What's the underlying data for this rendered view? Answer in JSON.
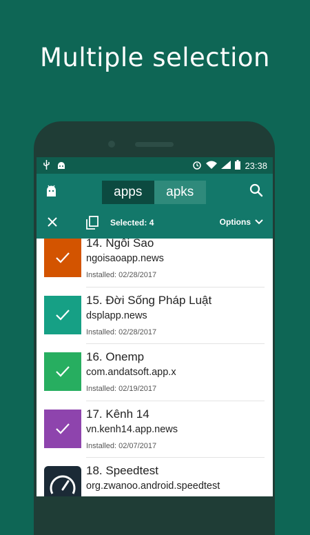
{
  "headline": "Multiple selection",
  "status_bar": {
    "time": "23:38"
  },
  "toolbar": {
    "tab_apps": "apps",
    "tab_apks": "apks",
    "active_tab": "apps"
  },
  "action_bar": {
    "selected": "Selected: 4",
    "options": "Options"
  },
  "apps": [
    {
      "title": "14. Ngôi Sao",
      "package": "ngoisaoapp.news",
      "installed": "Installed: 02/28/2017",
      "color": "#d35400",
      "selected": true
    },
    {
      "title": "15. Đời Sống Pháp Luật",
      "package": "dsplapp.news",
      "installed": "Installed: 02/28/2017",
      "color": "#16a085",
      "selected": true
    },
    {
      "title": "16. Onemp",
      "package": "com.andatsoft.app.x",
      "installed": "Installed: 02/19/2017",
      "color": "#27ae60",
      "selected": true
    },
    {
      "title": "17. Kênh 14",
      "package": "vn.kenh14.app.news",
      "installed": "Installed: 02/07/2017",
      "color": "#8e44ad",
      "selected": true
    },
    {
      "title": "18. Speedtest",
      "package": "org.zwanoo.android.speedtest",
      "installed": "",
      "color": "#1b2a36",
      "selected": false
    }
  ],
  "colors": {
    "background": "#0e6655",
    "toolbar": "#13786a",
    "statusbar": "#0f5d4e"
  }
}
